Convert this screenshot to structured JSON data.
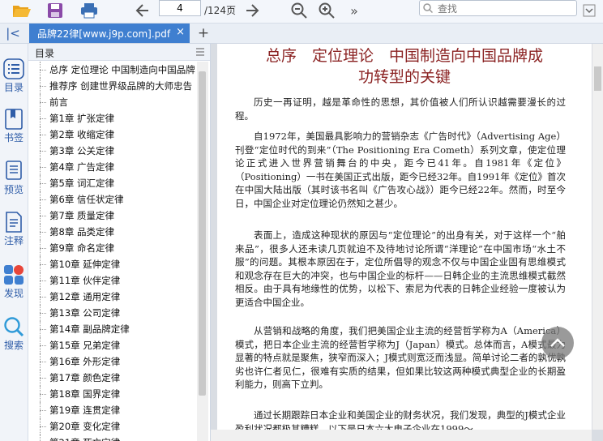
{
  "toolbar": {
    "page_current": "4",
    "page_total": "/124页",
    "search_placeholder": "查找"
  },
  "tab": {
    "title": "品牌22律[www.j9p.com].pdf",
    "close": "×",
    "new_tab": "+"
  },
  "sidebar": {
    "items": [
      {
        "label": "目录",
        "icon": "toc-icon"
      },
      {
        "label": "书签",
        "icon": "bookmark-icon"
      },
      {
        "label": "预览",
        "icon": "thumbnails-icon"
      },
      {
        "label": "注释",
        "icon": "annotation-icon"
      },
      {
        "label": "发现",
        "icon": "discover-icon"
      },
      {
        "label": "搜索",
        "icon": "search-icon"
      }
    ]
  },
  "outline": {
    "header": "目录",
    "items": [
      "总序 定位理论 中国制造向中国品牌成功转型的关键",
      "推荐序 创建世界级品牌的大师忠告",
      "前言",
      "第1章 扩张定律",
      "第2章 收缩定律",
      "第3章 公关定律",
      "第4章 广告定律",
      "第5章 词汇定律",
      "第6章 信任状定律",
      "第7章 质量定律",
      "第8章 品类定律",
      "第9章 命名定律",
      "第10章 延伸定律",
      "第11章 伙伴定律",
      "第12章 通用定律",
      "第13章 公司定律",
      "第14章 副品牌定律",
      "第15章 兄弟定律",
      "第16章 外形定律",
      "第17章 颜色定律",
      "第18章 国界定律",
      "第19章 连贯定律",
      "第20章 变化定律",
      "第21章 死亡定律"
    ]
  },
  "document": {
    "title_line1": "总序　定位理论　中国制造向中国品牌成",
    "title_line2": "功转型的关键",
    "paragraphs": [
      "历史一再证明，越是革命性的思想，其价值被人们所认识越需要漫长的过程。",
      "自1972年，美国最具影响力的营销杂志《广告时代》（Advertising Age）刊登“定位时代的到来”（The Positioning Era Cometh）系列文章，使定位理论正式进入世界营销舞台的中央，距今已41年。自1981年《定位》（Positioning）一书在美国正式出版，距今已经32年。自1991年《定位》首次在中国大陆出版（其时该书名叫《广告攻心战》）距今已经22年。然而，时至今日，中国企业对定位理论仍然知之甚少。",
      "表面上，造成这种现状的原因与“定位理论”的出身有关，对于这样一个“舶来品”，很多人还未读几页就迫不及待地讨论所谓“洋理论”在中国市场“水土不服”的问题。其根本原因在于，定位所倡导的观念不仅与中国企业固有思维模式和观念存在巨大的冲突，也与中国企业的标杆——日韩企业的主流思维模式截然相反。由于具有地缘性的优势，以松下、索尼为代表的日韩企业经验一度被认为更适合中国企业。",
      "从营销和战略的角度，我们把美国企业主流的经营哲学称为A（America）模式，把日本企业主流的经营哲学称为J（Japan）模式。总体而言，A模式最为显著的特点就是聚焦，狭窄而深入；J模式则宽泛而浅显。简单讨论二者的孰优孰劣也许仁者见仁，很难有实质的结果，但如果比较这两种模式典型企业的长期盈利能力，则高下立判。",
      "通过长期跟踪日本企业和美国企业的财务状况，我们发现，典型的J模式企业盈利状况都极其糟糕，以下是日本六大电子企业在1999～"
    ]
  },
  "colors": {
    "accent": "#3f7fd0",
    "title_red": "#8b2323"
  }
}
